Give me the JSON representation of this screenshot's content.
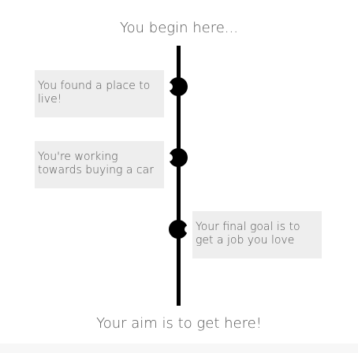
{
  "timeline": {
    "start_label": "You begin here...",
    "end_label": "Your aim is to get here!",
    "milestones": [
      {
        "text": "You found a place to live!",
        "side": "left"
      },
      {
        "text": "You're working towards buying a car",
        "side": "left"
      },
      {
        "text": "Your final goal is to get a job you love",
        "side": "right"
      }
    ]
  },
  "colors": {
    "line": "#000000",
    "card_background": "#eeeeee",
    "text": "#555555"
  }
}
